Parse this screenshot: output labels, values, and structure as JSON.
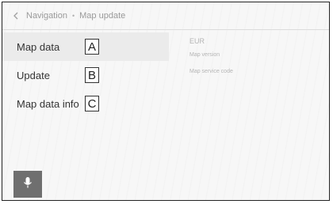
{
  "header": {
    "breadcrumb_parent": "Navigation",
    "separator": "•",
    "title": "Map update"
  },
  "menu": {
    "items": [
      {
        "label": "Map data",
        "callout": "A",
        "selected": true
      },
      {
        "label": "Update",
        "callout": "B",
        "selected": false
      },
      {
        "label": "Map data info",
        "callout": "C",
        "selected": false
      }
    ]
  },
  "details": {
    "region": "EUR",
    "map_version_label": "Map version",
    "map_service_code_label": "Map service code"
  },
  "icons": {
    "back": "chevron-left-icon",
    "voice": "microphone-icon"
  },
  "colors": {
    "selected_row": "#ebebeb",
    "mic_button": "#6f6f6f",
    "text_primary": "#333333",
    "text_muted": "#9a9a9a"
  }
}
